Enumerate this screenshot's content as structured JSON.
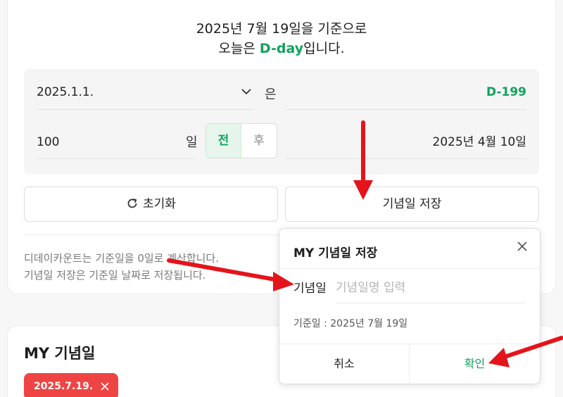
{
  "header": {
    "line1": "2025년 7월 19일을 기준으로",
    "line2_prefix": "오늘은 ",
    "line2_dday": "D-day",
    "line2_suffix": "입니다."
  },
  "calculator": {
    "date_value": "2025.1.1.",
    "particle": "은",
    "dday_result": "D-199",
    "days_value": "100",
    "days_unit": "일",
    "before_label": "전",
    "after_label": "후",
    "result_date": "2025년 4월 10일"
  },
  "buttons": {
    "reset_label": "초기화",
    "save_label": "기념일 저장"
  },
  "info": {
    "line1": "디데이카운트는 기준일을 0일로 계산합니다.",
    "line2": "기념일 저장은 기준일 날짜로 저장됩니다."
  },
  "my_anniversary": {
    "title": "MY 기념일",
    "tags": [
      {
        "label": "2025.7.19."
      }
    ]
  },
  "modal": {
    "title": "MY 기념일 저장",
    "field_label": "기념일",
    "field_placeholder": "기념일명 입력",
    "base_date_text": "기준일 : 2025년 7월 19일",
    "cancel_label": "취소",
    "confirm_label": "확인"
  },
  "colors": {
    "accent_green": "#11a35a",
    "tag_red": "#ef4444",
    "arrow_red": "#e4141b"
  },
  "icons": [
    "chevron-down-icon",
    "refresh-icon",
    "close-icon"
  ]
}
